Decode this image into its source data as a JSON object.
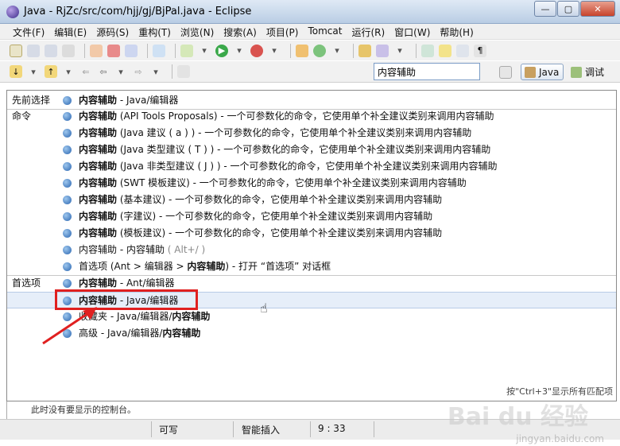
{
  "window": {
    "title": "Java - RjZc/src/com/hjj/gj/BjPal.java - Eclipse",
    "min": "—",
    "max": "▢",
    "close": "✕"
  },
  "menus": [
    "文件(F)",
    "编辑(E)",
    "源码(S)",
    "重构(T)",
    "浏览(N)",
    "搜索(A)",
    "项目(P)",
    "Tomcat",
    "运行(R)",
    "窗口(W)",
    "帮助(H)"
  ],
  "quick_access": {
    "value": "内容辅助"
  },
  "perspectives": {
    "java": "Java",
    "debug": "调试"
  },
  "sections": {
    "previous": "先前选择",
    "commands": "命令",
    "preferences": "首选项"
  },
  "rows": {
    "r0": {
      "b": "内容辅助",
      "t": " - Java/编辑器"
    },
    "r1": {
      "b": "内容辅助",
      "t": " (API Tools Proposals) - 一个可参数化的命令，它使用单个补全建议类别来调用内容辅助"
    },
    "r2": {
      "b": "内容辅助",
      "t": " (Java 建议 ( a ) ) - 一个可参数化的命令，它使用单个补全建议类别来调用内容辅助"
    },
    "r3": {
      "b": "内容辅助",
      "t": " (Java 类型建议 ( T ) ) - 一个可参数化的命令，它使用单个补全建议类别来调用内容辅助"
    },
    "r4": {
      "b": "内容辅助",
      "t": " (Java 非类型建议 ( J ) ) - 一个可参数化的命令，它使用单个补全建议类别来调用内容辅助"
    },
    "r5": {
      "b": "内容辅助",
      "t": " (SWT 模板建议) - 一个可参数化的命令，它使用单个补全建议类别来调用内容辅助"
    },
    "r6": {
      "b": "内容辅助",
      "t": " (基本建议) - 一个可参数化的命令，它使用单个补全建议类别来调用内容辅助"
    },
    "r7": {
      "b": "内容辅助",
      "t": " (字建议) - 一个可参数化的命令，它使用单个补全建议类别来调用内容辅助"
    },
    "r8": {
      "b": "内容辅助",
      "t": " (模板建议) - 一个可参数化的命令，它使用单个补全建议类别来调用内容辅助"
    },
    "r9": {
      "t": "内容辅助 - 内容辅助",
      "g": " ( Alt+/ )"
    },
    "r10": {
      "a": "首选项 (Ant > 编辑器 > ",
      "b": "内容辅助",
      "c": ") - 打开 “首选项” 对话框"
    },
    "r11": {
      "b": "内容辅助",
      "t": " - Ant/编辑器"
    },
    "r12": {
      "b": "内容辅助",
      "t": " - Java/编辑器"
    },
    "r13": {
      "a": "收藏夹 - Java/编辑器/",
      "b": "内容辅助"
    },
    "r14": {
      "a": "高级 - Java/编辑器/",
      "b": "内容辅助"
    }
  },
  "hint": "按\"Ctrl+3\"显示所有匹配项",
  "underlying_text": "此时没有要显示的控制台。",
  "status": {
    "writable": "可写",
    "insert_mode": "智能插入",
    "position": "9 : 33"
  },
  "watermark": {
    "brand": "Bai du 经验",
    "url": "jingyan.baidu.com"
  },
  "colors": {
    "highlight": "#e6eef9",
    "annotation": "#e02020",
    "bullet": "#2a65b0"
  }
}
